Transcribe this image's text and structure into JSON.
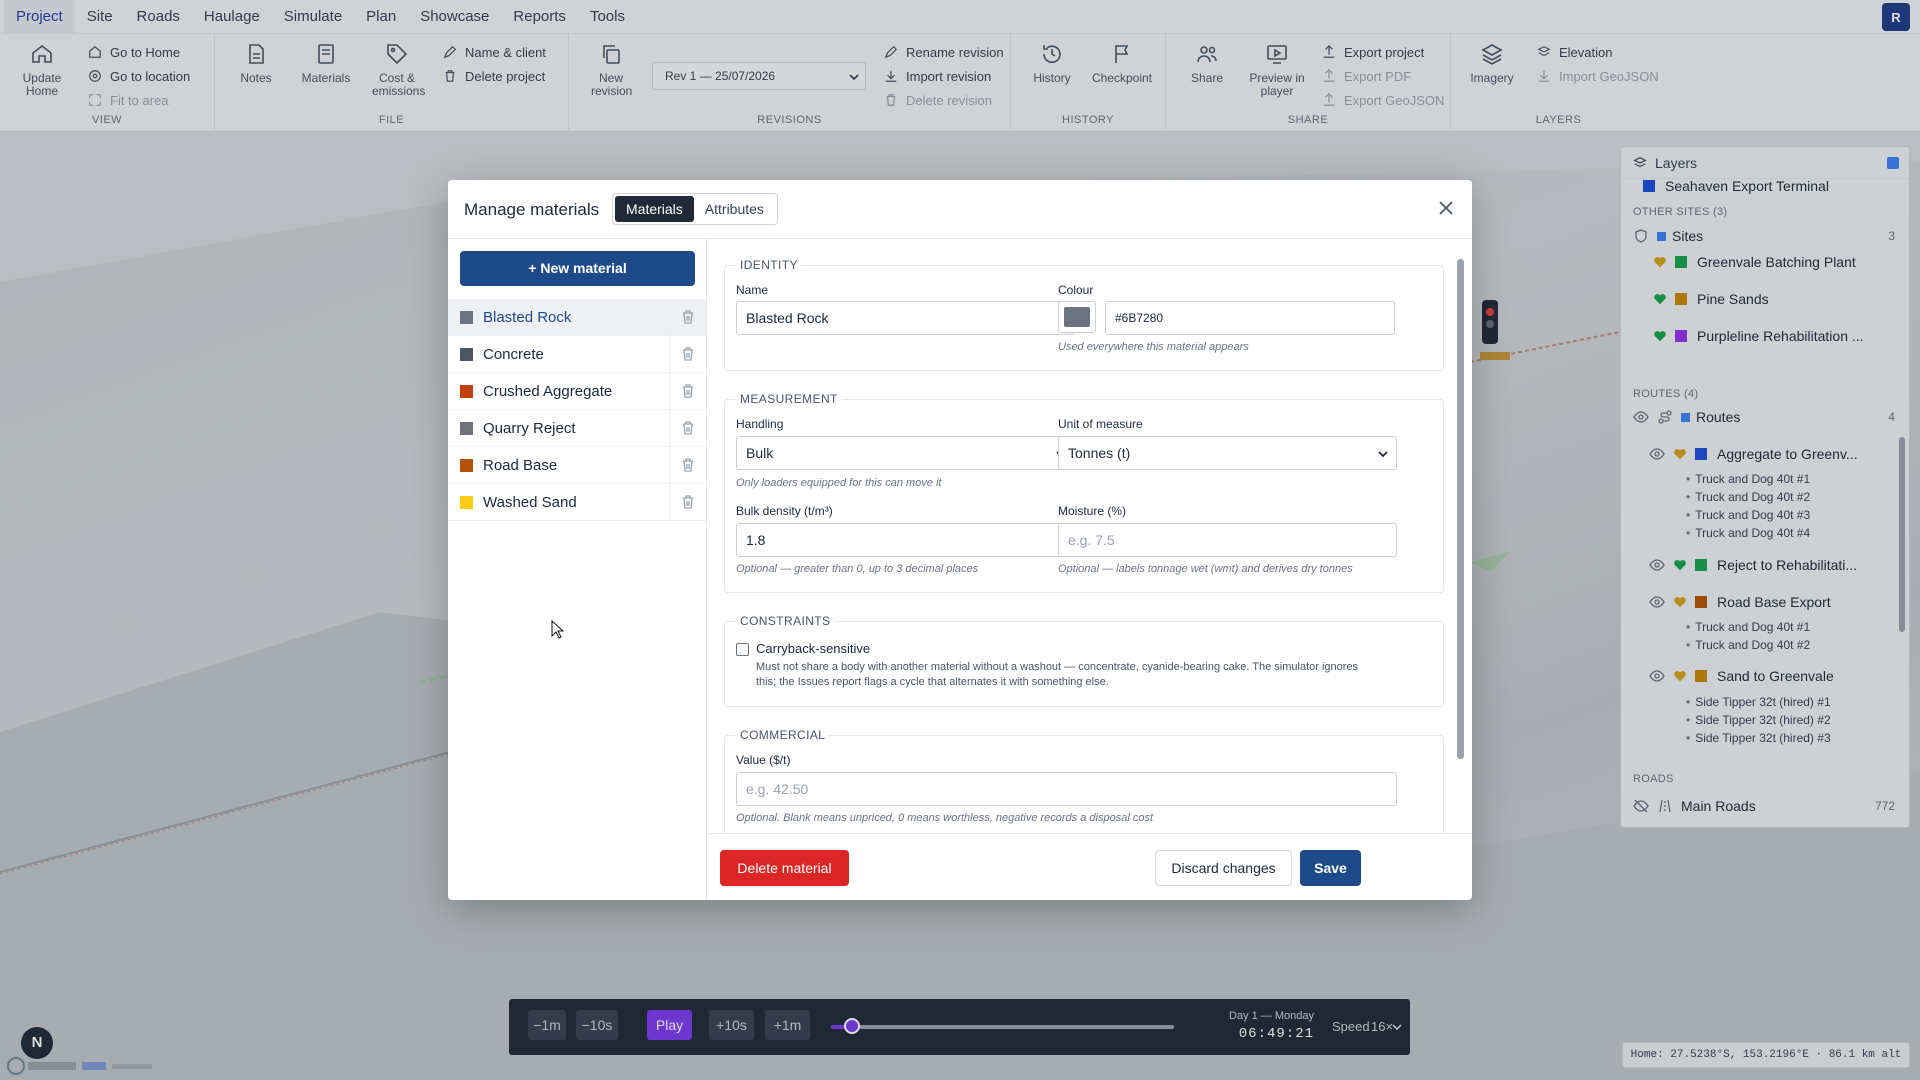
{
  "menubar": {
    "items": [
      "Project",
      "Site",
      "Roads",
      "Haulage",
      "Simulate",
      "Plan",
      "Showcase",
      "Reports",
      "Tools"
    ],
    "active": "Project",
    "avatar": "R"
  },
  "ribbon": {
    "view": {
      "label": "VIEW",
      "update_home": "Update Home",
      "go_home": "Go to Home",
      "go_location": "Go to location",
      "fit_area": "Fit to area"
    },
    "file": {
      "label": "FILE",
      "notes": "Notes",
      "materials": "Materials",
      "cost": "Cost & emissions",
      "name_client": "Name & client",
      "delete_project": "Delete project"
    },
    "revisions": {
      "label": "REVISIONS",
      "new_revision": "New revision",
      "selected": "Rev 1 — 25/07/2026",
      "rename": "Rename revision",
      "import": "Import revision",
      "delete": "Delete revision"
    },
    "history": {
      "label": "HISTORY",
      "history": "History",
      "checkpoint": "Checkpoint"
    },
    "share": {
      "label": "SHARE",
      "share": "Share",
      "preview": "Preview in player",
      "export_project": "Export project",
      "export_pdf": "Export PDF",
      "export_geojson": "Export GeoJSON"
    },
    "layers": {
      "label": "LAYERS",
      "imagery": "Imagery",
      "elevation": "Elevation",
      "import_geojson": "Import GeoJSON"
    }
  },
  "layers_panel": {
    "title": "Layers",
    "top_item": "Seahaven Export Terminal",
    "other_sites_label": "OTHER SITES (3)",
    "sites": {
      "label": "Sites",
      "count": "3",
      "items": [
        {
          "name": "Greenvale Batching Plant",
          "color": "#16a34a"
        },
        {
          "name": "Pine Sands",
          "color": "#ca8a04"
        },
        {
          "name": "Purpleline Rehabilitation ...",
          "color": "#9333ea"
        }
      ]
    },
    "routes_label": "ROUTES (4)",
    "routes": {
      "label": "Routes",
      "count": "4",
      "items": [
        {
          "name": "Aggregate to Greenv...",
          "color": "#1d4ed8",
          "vehicles": [
            "Truck and Dog 40t #1",
            "Truck and Dog 40t #2",
            "Truck and Dog 40t #3",
            "Truck and Dog 40t #4"
          ]
        },
        {
          "name": "Reject to Rehabilitati...",
          "color": "#16a34a",
          "vehicles": []
        },
        {
          "name": "Road Base Export",
          "color": "#b45309",
          "vehicles": [
            "Truck and Dog 40t #1",
            "Truck and Dog 40t #2"
          ]
        },
        {
          "name": "Sand to Greenvale",
          "color": "#ca8a04",
          "vehicles": [
            "Side Tipper 32t (hired) #1",
            "Side Tipper 32t (hired) #2",
            "Side Tipper 32t (hired) #3"
          ]
        }
      ]
    },
    "roads_label": "ROADS",
    "main_roads": {
      "label": "Main Roads",
      "count": "772"
    }
  },
  "modal": {
    "title": "Manage materials",
    "tabs": [
      "Materials",
      "Attributes"
    ],
    "active_tab": "Materials",
    "new_material": "+ New material",
    "materials": [
      {
        "name": "Blasted Rock",
        "color": "#6b7280",
        "selected": true
      },
      {
        "name": "Concrete",
        "color": "#4b5563"
      },
      {
        "name": "Crushed Aggregate",
        "color": "#c2410c"
      },
      {
        "name": "Quarry Reject",
        "color": "#71717a"
      },
      {
        "name": "Road Base",
        "color": "#b45309"
      },
      {
        "name": "Washed Sand",
        "color": "#facc15"
      }
    ],
    "identity": {
      "title": "IDENTITY",
      "name_label": "Name",
      "name_value": "Blasted Rock",
      "colour_label": "Colour",
      "colour_value": "#6B7280",
      "colour_hint": "Used everywhere this material appears"
    },
    "measurement": {
      "title": "MEASUREMENT",
      "handling_label": "Handling",
      "handling_value": "Bulk",
      "handling_hint": "Only loaders equipped for this can move it",
      "unit_label": "Unit of measure",
      "unit_value": "Tonnes (t)",
      "density_label": "Bulk density (t/m³)",
      "density_value": "1.8",
      "density_hint": "Optional — greater than 0, up to 3 decimal places",
      "moisture_label": "Moisture (%)",
      "moisture_placeholder": "e.g. 7.5",
      "moisture_hint": "Optional — labels tonnage wet (wmt) and derives dry tonnes"
    },
    "constraints": {
      "title": "CONSTRAINTS",
      "carryback_label": "Carryback-sensitive",
      "carryback_checked": false,
      "carryback_desc1": "Must not share a body with another material without a washout — concentrate, cyanide-bearing cake. The simulator ignores",
      "carryback_desc2": "this; the Issues report flags a cycle that alternates it with something else."
    },
    "commercial": {
      "title": "COMMERCIAL",
      "value_label": "Value ($/t)",
      "value_placeholder": "e.g. 42.50",
      "value_hint": "Optional. Blank means unpriced, 0 means worthless, negative records a disposal cost"
    },
    "footer": {
      "delete": "Delete material",
      "discard": "Discard changes",
      "save": "Save"
    }
  },
  "timeline": {
    "minus_1m": "−1m",
    "minus_10s": "−10s",
    "play": "Play",
    "plus_10s": "+10s",
    "plus_1m": "+1m",
    "progress": 0.06,
    "day": "Day 1 — Monday",
    "clock": "06:49:21",
    "speed_label": "Speed",
    "speed": "16×"
  },
  "compass": "N",
  "home_coords": "Home: 27.5238°S, 153.2196°E · 86.1 km alt",
  "colors": {
    "primary": "#1e4a8a",
    "danger": "#dc2626",
    "accent": "#7c3aed"
  }
}
